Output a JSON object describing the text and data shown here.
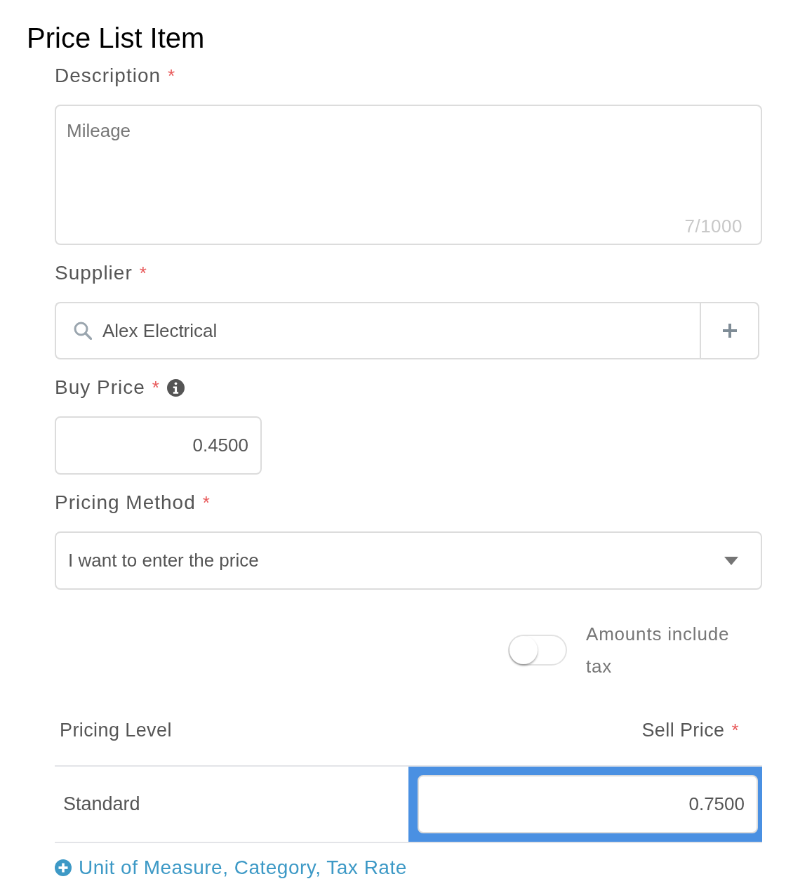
{
  "title": "Price List Item",
  "fields": [
    {
      "kind": "textarea",
      "label": "Description",
      "required_mark": "*",
      "value": "Mileage",
      "counter": "7/1000"
    },
    {
      "kind": "search",
      "label": "Supplier",
      "required_mark": "*",
      "value": "Alex Electrical"
    },
    {
      "kind": "number",
      "label": "Buy Price",
      "required_mark": "*",
      "info": true,
      "value": "0.4500"
    },
    {
      "kind": "select",
      "label": "Pricing Method",
      "required_mark": "*",
      "value": "I want to enter the price"
    }
  ],
  "tax_toggle": {
    "label": "Amounts include tax",
    "on": false
  },
  "pricing_table": {
    "columns": [
      {
        "label": "Pricing Level"
      },
      {
        "label": "Sell Price",
        "required_mark": "*"
      }
    ],
    "rows": [
      {
        "level": "Standard",
        "sell_price": "0.7500",
        "selected": true
      }
    ]
  },
  "more_fields_link": "Unit of Measure, Category, Tax Rate"
}
